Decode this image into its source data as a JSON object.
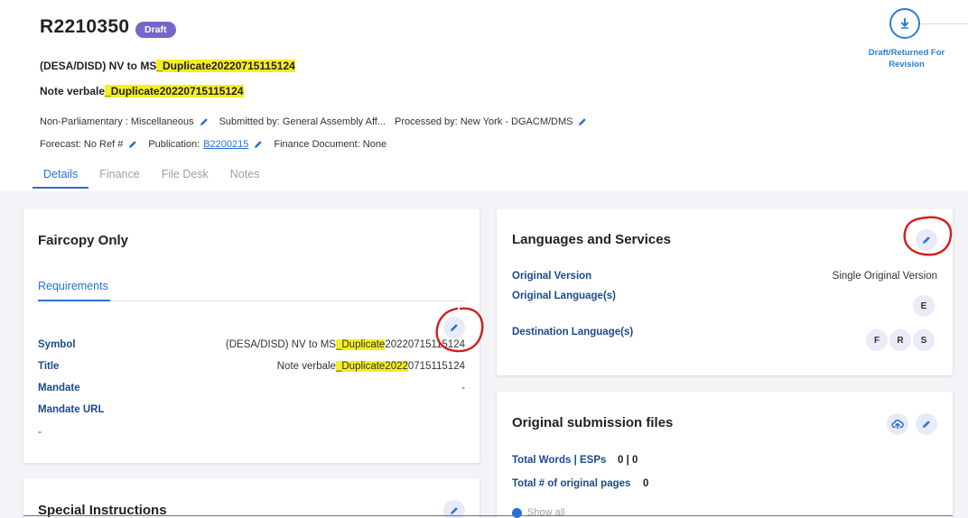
{
  "header": {
    "doc_id": "R2210350",
    "status": "Draft",
    "title_prefix": "(DESA/DISD) NV to MS",
    "title_highlight": "_Duplicate20220715115124",
    "subtitle_prefix": "Note verbale",
    "subtitle_highlight": "_Duplicate20220715115124",
    "meta1": {
      "category": "Non-Parliamentary : Miscellaneous",
      "submitted_by": "Submitted by: General Assembly Aff...",
      "processed_by": "Processed by: New York - DGACM/DMS"
    },
    "meta2": {
      "forecast": "Forecast: No Ref #",
      "publication_label": "Publication:",
      "publication_value": "B2200215",
      "finance_document": "Finance Document: None"
    },
    "tabs": [
      "Details",
      "Finance",
      "File Desk",
      "Notes"
    ],
    "workflow_step": "Draft/Returned For Revision"
  },
  "faircopy": {
    "title": "Faircopy Only",
    "tab": "Requirements",
    "rows": {
      "symbol_label": "Symbol",
      "symbol_prefix": "(DESA/DISD) NV to MS",
      "symbol_highlight": "_Duplicate",
      "symbol_suffix": "20220715115124",
      "title_label": "Title",
      "title_prefix": "Note verbale",
      "title_highlight": "_Duplicate2022",
      "title_suffix": "0715115124",
      "mandate_label": "Mandate",
      "mandate_value": "-",
      "mandate_url_label": "Mandate URL",
      "mandate_url_value": "-"
    }
  },
  "special": {
    "title": "Special Instructions"
  },
  "languages": {
    "title": "Languages and Services",
    "original_version_label": "Original Version",
    "original_version_value": "Single Original Version",
    "original_language_label": "Original Language(s)",
    "original_languages": [
      "E"
    ],
    "destination_label": "Destination Language(s)",
    "destination_languages": [
      "F",
      "R",
      "S"
    ]
  },
  "submission": {
    "title": "Original submission files",
    "total_words_label": "Total Words | ESPs",
    "total_words_value": "0 | 0",
    "total_pages_label": "Total # of original pages",
    "total_pages_value": "0",
    "show_all": "Show all"
  },
  "colors": {
    "accent": "#2a6fd6",
    "draft": "#7367c8",
    "highlight": "#f5ef1e",
    "annotation": "#d21d1d"
  }
}
